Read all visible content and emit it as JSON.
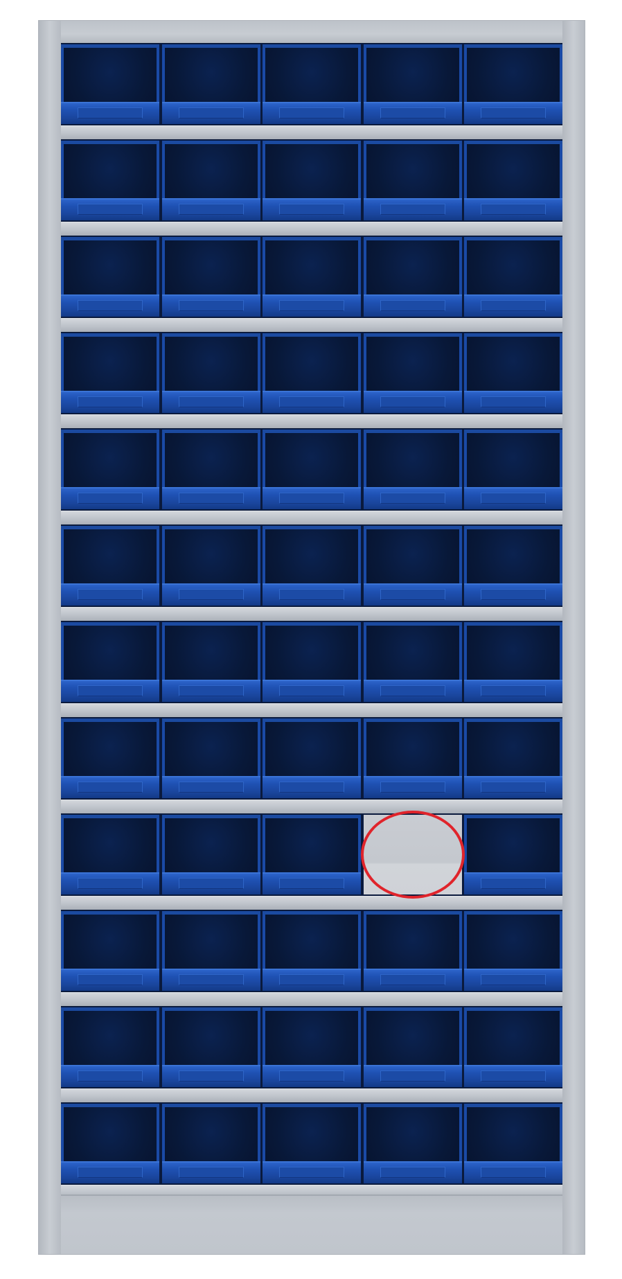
{
  "image": {
    "subject": "storage-cabinet",
    "frame_color": "#c3c8cf",
    "bin_color": "#1f52b4",
    "bin_interior_color": "#081838",
    "highlight_color": "#e0242b"
  },
  "cabinet": {
    "rows": 12,
    "columns": 5,
    "missing_bin": {
      "row": 9,
      "column": 4
    },
    "highlight": {
      "row": 9,
      "column": 4,
      "shape": "ellipse"
    }
  }
}
